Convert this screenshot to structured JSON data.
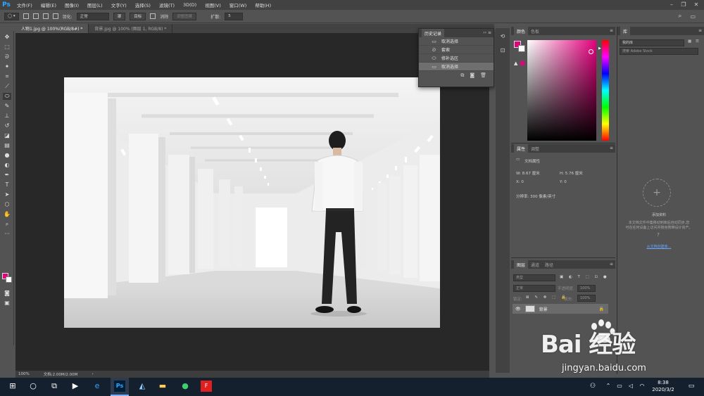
{
  "app": {
    "logo": "Ps",
    "menu": [
      "文件(F)",
      "编辑(E)",
      "图像(I)",
      "图层(L)",
      "文字(Y)",
      "选择(S)",
      "滤镜(T)",
      "3D(D)",
      "视图(V)",
      "窗口(W)",
      "帮助(H)"
    ]
  },
  "options_bar": {
    "feather_label": "羽化:",
    "feather_value": "正常",
    "btn1": "罩",
    "btn2": "目标",
    "antialias_label": "消除",
    "btn_disabled": "调整图案",
    "expand_label": "扩散:",
    "expand_value": "5"
  },
  "tabs": [
    {
      "label": "人物1.jpg @ 100%(RGB/8#) *"
    },
    {
      "label": "背景.jpg @ 100% (图层 1, RGB/8) *"
    }
  ],
  "history_panel": {
    "title": "历史记录",
    "rows": [
      "取消选择",
      "套索",
      "修补选区",
      "取消选择"
    ]
  },
  "color_panel": {
    "tab_active": "颜色",
    "tab_inactive": "色板",
    "colors": {
      "foreground": "#e6007e",
      "background": "#ffffff"
    }
  },
  "properties_panel": {
    "tab_active": "属性",
    "tab_inactive": "调整",
    "title": "文档属性",
    "w": "W:  8.67 厘米",
    "h": "H:  5.76 厘米",
    "x": "X:  0",
    "y": "Y:  0",
    "resolution": "分辨率: 300 像素/英寸"
  },
  "layers_panel": {
    "tabs": [
      "图层",
      "通道",
      "路径"
    ],
    "filter_placeholder": "类型",
    "blend_mode": "正常",
    "opacity_label": "不透明度:",
    "opacity_value": "100%",
    "lock_label": "锁定:",
    "fill_label": "填充:",
    "fill_value": "100%",
    "layer_name": "背景"
  },
  "library_panel": {
    "title": "库",
    "select": "我的库",
    "search_placeholder": "搜索 Adobe Stock",
    "add_title": "添加资料",
    "desc_line1": "本文档文件中集移动到库后自动同步,您",
    "desc_line2": "可在任何设备上访问并随身携带设计资产。",
    "link": "从文档创建库..."
  },
  "status": {
    "zoom": "100%",
    "doc": "文档:2.00M/2.00M"
  },
  "taskbar": {
    "time": "8:38",
    "date": "2020/3/2"
  },
  "watermark": {
    "brand": "Bai  经验",
    "url": "jingyan.baidu.com"
  }
}
